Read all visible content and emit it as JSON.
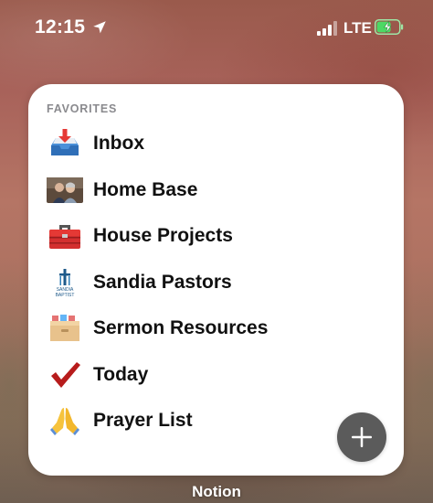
{
  "status_bar": {
    "time": "12:15",
    "network": "LTE",
    "icons": [
      "location-arrow-icon",
      "cellular-signal-icon",
      "battery-charging-icon"
    ]
  },
  "widget": {
    "header": "FAVORITES",
    "items": [
      {
        "label": "Inbox",
        "icon": "inbox-tray-icon"
      },
      {
        "label": "Home Base",
        "icon": "photo-thumbnail-icon"
      },
      {
        "label": "House Projects",
        "icon": "toolbox-icon"
      },
      {
        "label": "Sandia Pastors",
        "icon": "sandia-baptist-logo-icon",
        "logo_text": "SANDIA BAPTIST"
      },
      {
        "label": "Sermon Resources",
        "icon": "card-file-box-icon"
      },
      {
        "label": "Today",
        "icon": "check-mark-icon"
      },
      {
        "label": "Prayer List",
        "icon": "folded-hands-icon"
      }
    ],
    "add_button_icon": "plus-icon"
  },
  "caption": "Notion",
  "colors": {
    "widget_bg": "#ffffff",
    "header_text": "#8a8a8e",
    "item_text": "#111111",
    "add_button": "#5b5b5b",
    "check_mark": "#b71c1c",
    "battery": "#4cd964"
  }
}
